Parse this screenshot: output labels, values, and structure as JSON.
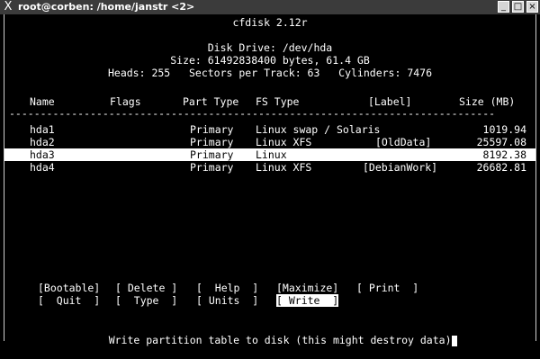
{
  "window": {
    "title": "root@corben: /home/janstr <2>",
    "menu_icon": "X",
    "buttons": [
      "_",
      "□",
      "×"
    ]
  },
  "header": {
    "app": "cfdisk 2.12r",
    "disk_drive": "Disk Drive: /dev/hda",
    "size": "Size: 61492838400 bytes, 61.4 GB",
    "geometry": "Heads: 255   Sectors per Track: 63   Cylinders: 7476"
  },
  "table": {
    "columns": [
      "Name",
      "Flags",
      "Part Type",
      "FS Type",
      "[Label]",
      "Size (MB)"
    ],
    "separator": "------------------------------------------------------------------------------",
    "rows": [
      {
        "name": "hda1",
        "flags": "",
        "part_type": "Primary",
        "fs_type": "Linux swap / Solaris",
        "label": "",
        "size": "1019.94"
      },
      {
        "name": "hda2",
        "flags": "",
        "part_type": "Primary",
        "fs_type": "Linux XFS",
        "label": "[OldData]",
        "size": "25597.08"
      },
      {
        "name": "hda3",
        "flags": "",
        "part_type": "Primary",
        "fs_type": "Linux",
        "label": "",
        "size": "8192.38"
      },
      {
        "name": "hda4",
        "flags": "",
        "part_type": "Primary",
        "fs_type": "Linux XFS",
        "label": "[DebianWork]",
        "size": "26682.81"
      }
    ]
  },
  "menu": {
    "bootable": "[Bootable]",
    "delete": "[ Delete ]",
    "help": "[  Help  ]",
    "maximize": "[Maximize]",
    "print": "[ Print  ]",
    "quit": "[  Quit  ]",
    "type": "[  Type  ]",
    "units": "[ Units  ]",
    "write": "[ Write  ]"
  },
  "status": "Write partition table to disk (this might destroy data)"
}
